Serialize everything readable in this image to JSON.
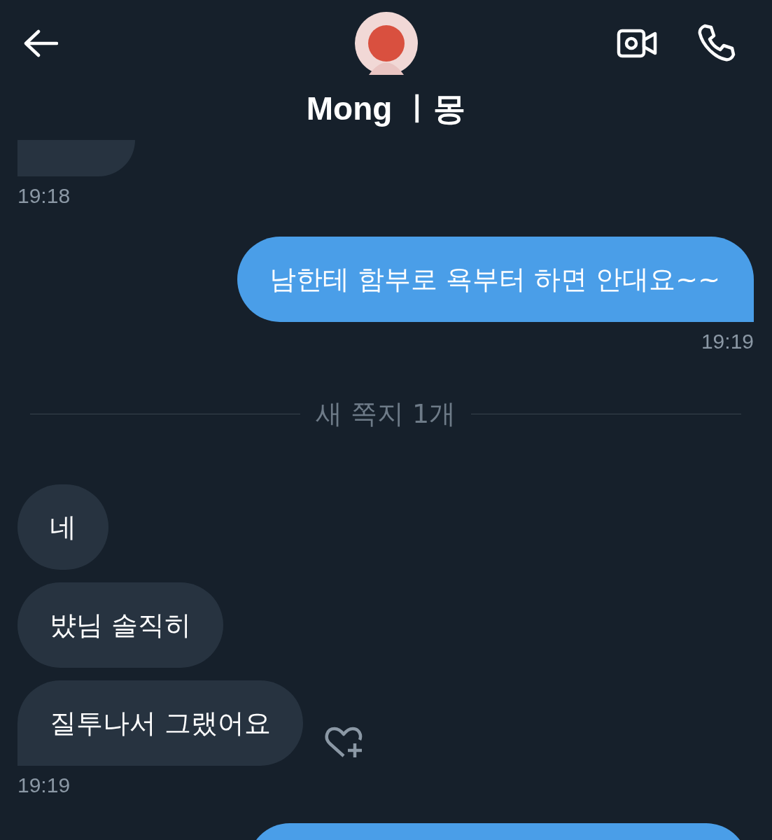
{
  "header": {
    "name": "Mong ㅣ몽"
  },
  "messages": [
    {
      "kind": "partial_received"
    },
    {
      "kind": "time_received",
      "text": "19:18"
    },
    {
      "kind": "bubble_sent",
      "text": "남한테 함부로 욕부터 하면 안대요~~",
      "tail": true
    },
    {
      "kind": "time_sent",
      "text": "19:19"
    },
    {
      "kind": "divider",
      "text": "새 쪽지 1개"
    },
    {
      "kind": "bubble_received",
      "text": "네",
      "tail": false
    },
    {
      "kind": "bubble_received",
      "text": "뱠님 솔직히",
      "tail": false
    },
    {
      "kind": "bubble_received",
      "text": "질투나서 그랬어요",
      "tail": true,
      "reaction_button": true
    },
    {
      "kind": "time_received",
      "text": "19:19"
    },
    {
      "kind": "partial_sent"
    }
  ]
}
